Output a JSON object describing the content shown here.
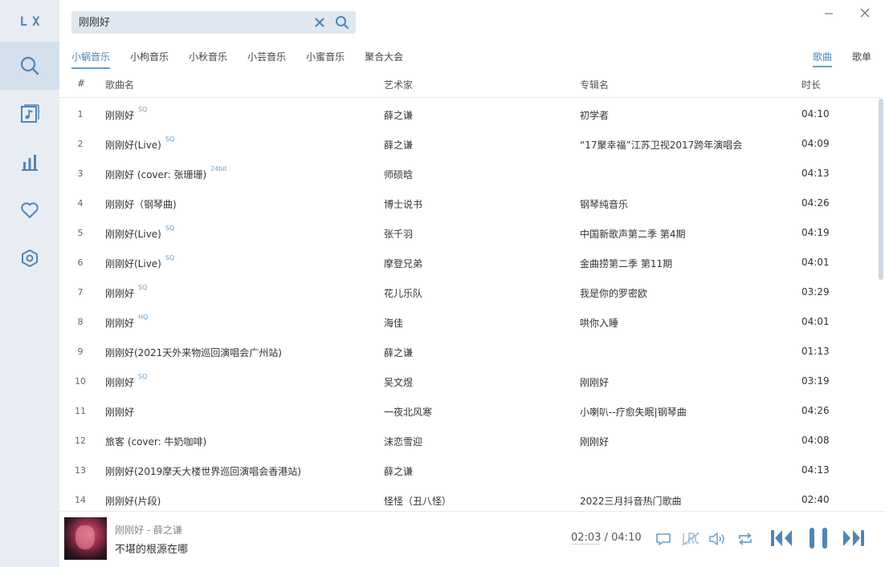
{
  "app": {
    "logo": "LX"
  },
  "search": {
    "value": "刚刚好",
    "placeholder": ""
  },
  "source_tabs": [
    "小蜗音乐",
    "小枸音乐",
    "小秋音乐",
    "小芸音乐",
    "小蜜音乐",
    "聚合大会"
  ],
  "type_tabs": [
    "歌曲",
    "歌单"
  ],
  "columns": {
    "num": "#",
    "name": "歌曲名",
    "artist": "艺术家",
    "album": "专辑名",
    "duration": "时长"
  },
  "songs": [
    {
      "num": "1",
      "name": "刚刚好",
      "badge": "SQ",
      "artist": "薛之谦",
      "album": "初学者",
      "duration": "04:10"
    },
    {
      "num": "2",
      "name": "刚刚好(Live)",
      "badge": "SQ",
      "artist": "薛之谦",
      "album": "“17聚幸福”江苏卫视2017跨年演唱会",
      "duration": "04:09"
    },
    {
      "num": "3",
      "name": "刚刚好 (cover: 张珊珊)",
      "badge": "24bit",
      "artist": "师硕晗",
      "album": "",
      "duration": "04:13"
    },
    {
      "num": "4",
      "name": "刚刚好（钢琴曲)",
      "badge": "",
      "artist": "博士说书",
      "album": "钢琴纯音乐",
      "duration": "04:26"
    },
    {
      "num": "5",
      "name": "刚刚好(Live)",
      "badge": "SQ",
      "artist": "张千羽",
      "album": "中国新歌声第二季 第4期",
      "duration": "04:19"
    },
    {
      "num": "6",
      "name": "刚刚好(Live)",
      "badge": "SQ",
      "artist": "摩登兄弟",
      "album": "金曲捞第二季 第11期",
      "duration": "04:01"
    },
    {
      "num": "7",
      "name": "刚刚好",
      "badge": "SQ",
      "artist": "花儿乐队",
      "album": "我是你的罗密欧",
      "duration": "03:29"
    },
    {
      "num": "8",
      "name": "刚刚好",
      "badge": "HQ",
      "artist": "海佳",
      "album": "哄你入睡",
      "duration": "04:01"
    },
    {
      "num": "9",
      "name": "刚刚好(2021天外来物巡回演唱会广州站)",
      "badge": "",
      "artist": "薛之谦",
      "album": "",
      "duration": "01:13"
    },
    {
      "num": "10",
      "name": "刚刚好",
      "badge": "SQ",
      "artist": "吴文煜",
      "album": "刚刚好",
      "duration": "03:19"
    },
    {
      "num": "11",
      "name": "刚刚好",
      "badge": "",
      "artist": "一夜北风寒",
      "album": "小喇叭--疗愈失眠|钢琴曲",
      "duration": "04:26"
    },
    {
      "num": "12",
      "name": "旅客 (cover: 牛奶咖啡)",
      "badge": "",
      "artist": "沫恋雪迎",
      "album": "刚刚好",
      "duration": "04:08"
    },
    {
      "num": "13",
      "name": "刚刚好(2019摩天大楼世界巡回演唱会香港站)",
      "badge": "",
      "artist": "薛之谦",
      "album": "",
      "duration": "04:13"
    },
    {
      "num": "14",
      "name": "刚刚好(片段)",
      "badge": "",
      "artist": "怪怪（丑八怪）",
      "album": "2022三月抖音热门歌曲",
      "duration": "02:40"
    }
  ],
  "player": {
    "track": "刚刚好 - 薛之谦",
    "lyric": "不堪的根源在哪",
    "current_time": "02:03",
    "separator": "/",
    "total_time": "04:10"
  },
  "colors": {
    "accent": "#4d87b6",
    "sidebar_bg": "#e8edf3",
    "icon": "#4f86b5"
  },
  "icons": {
    "sidebar": [
      "search-icon",
      "music-list-icon",
      "chart-icon",
      "heart-icon",
      "settings-icon"
    ],
    "window": [
      "minimize-icon",
      "close-icon"
    ],
    "player": [
      "comment-icon",
      "lyric-icon",
      "volume-icon",
      "repeat-icon",
      "previous-icon",
      "pause-icon",
      "next-icon"
    ]
  }
}
